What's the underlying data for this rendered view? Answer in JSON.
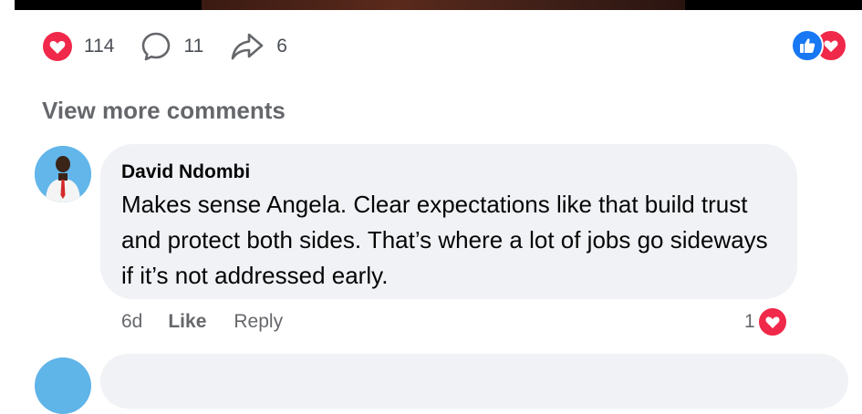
{
  "post": {
    "stats": {
      "reactions_count": "114",
      "comments_count": "11",
      "shares_count": "6"
    },
    "reaction_summary": [
      "like-icon",
      "love-icon"
    ],
    "view_more_label": "View more comments"
  },
  "comment": {
    "author": "David Ndombi",
    "text": "Makes sense Angela. Clear expectations like that build trust and protect both sides. That’s where a lot of jobs go sideways if it’s not addressed early.",
    "time": "6d",
    "like_label": "Like",
    "reply_label": "Reply",
    "reaction_count": "1",
    "reaction_icon": "love-icon"
  },
  "colors": {
    "love_red": "#f02849",
    "like_blue": "#1877f2",
    "bubble_bg": "#f0f2f5",
    "secondary_text": "#65676b"
  }
}
